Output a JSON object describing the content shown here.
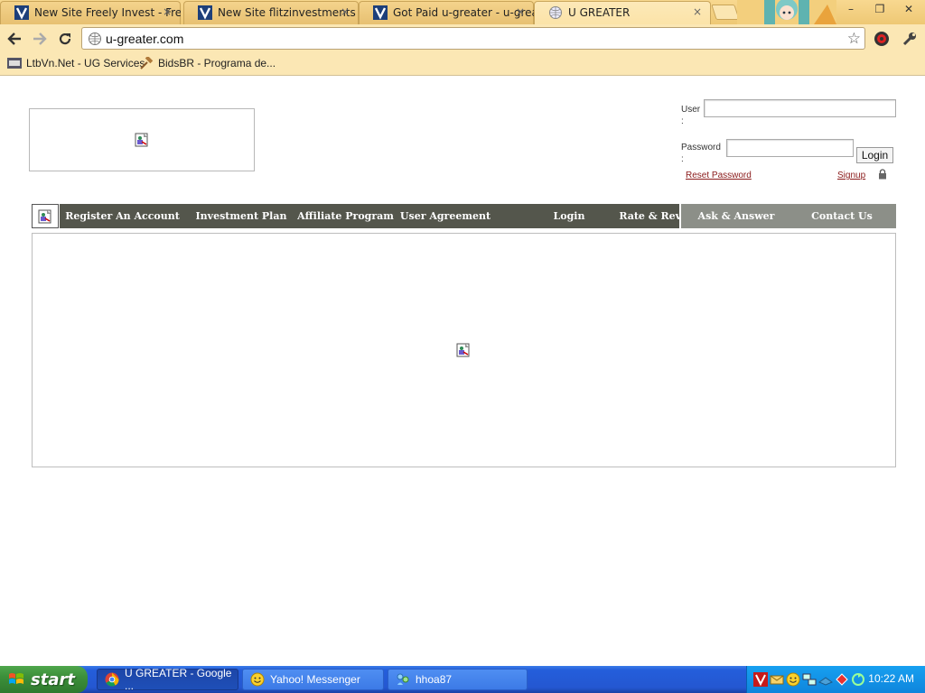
{
  "browser": {
    "tabs": [
      {
        "title": "New Site Freely Invest - Freel"
      },
      {
        "title": "New Site flitzinvestments - flitz"
      },
      {
        "title": "Got Paid u-greater - u-greater"
      },
      {
        "title": "U GREATER"
      }
    ],
    "close_glyph": "×",
    "url": "u-greater.com",
    "star_glyph": "☆",
    "bookmarks": [
      {
        "label": "LtbVn.Net - UG Services"
      },
      {
        "label": "BidsBR - Programa de..."
      }
    ],
    "window_controls": {
      "minimize": "–",
      "restore": "❐",
      "close": "✕"
    }
  },
  "page": {
    "login": {
      "user_label": "User :",
      "password_label": "Password :",
      "login_button": "Login",
      "reset_link": "Reset Password",
      "signup_link": "Signup"
    },
    "nav": {
      "items": [
        {
          "label": "Register An Account"
        },
        {
          "label": "Investment Plan"
        },
        {
          "label": "Affiliate Program"
        },
        {
          "label": "User Agreement"
        },
        {
          "label": "Login"
        },
        {
          "label": "Rate & Review"
        }
      ],
      "secondary_items": [
        {
          "label": "Ask & Answer"
        },
        {
          "label": "Contact Us"
        }
      ]
    }
  },
  "taskbar": {
    "start_label": "start",
    "tasks": [
      {
        "label": "U GREATER - Google ..."
      },
      {
        "label": "Yahoo! Messenger"
      },
      {
        "label": "hhoa87"
      }
    ],
    "clock": "10:22 AM"
  },
  "colors": {
    "nav_dark": "#54564c",
    "nav_light": "#8c8f88",
    "link": "#8a1a1a",
    "browser_chrome": "#fbe7b4"
  }
}
